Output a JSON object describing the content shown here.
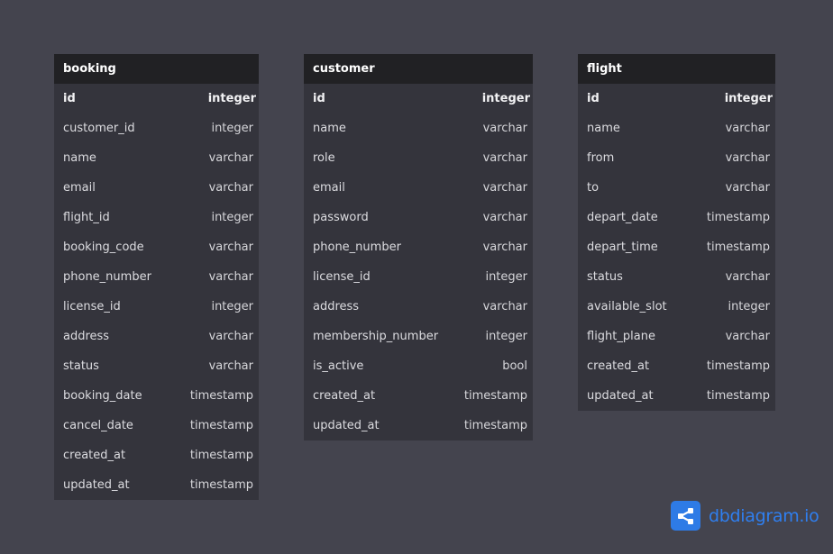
{
  "tables": [
    {
      "name": "booking",
      "columns": [
        {
          "name": "id",
          "type": "integer",
          "pk": true
        },
        {
          "name": "customer_id",
          "type": "integer"
        },
        {
          "name": "name",
          "type": "varchar"
        },
        {
          "name": "email",
          "type": "varchar"
        },
        {
          "name": "flight_id",
          "type": "integer"
        },
        {
          "name": "booking_code",
          "type": "varchar"
        },
        {
          "name": "phone_number",
          "type": "varchar"
        },
        {
          "name": "license_id",
          "type": "integer"
        },
        {
          "name": "address",
          "type": "varchar"
        },
        {
          "name": "status",
          "type": "varchar"
        },
        {
          "name": "booking_date",
          "type": "timestamp"
        },
        {
          "name": "cancel_date",
          "type": "timestamp"
        },
        {
          "name": "created_at",
          "type": "timestamp"
        },
        {
          "name": "updated_at",
          "type": "timestamp"
        }
      ]
    },
    {
      "name": "customer",
      "columns": [
        {
          "name": "id",
          "type": "integer",
          "pk": true
        },
        {
          "name": "name",
          "type": "varchar"
        },
        {
          "name": "role",
          "type": "varchar"
        },
        {
          "name": "email",
          "type": "varchar"
        },
        {
          "name": "password",
          "type": "varchar"
        },
        {
          "name": "phone_number",
          "type": "varchar"
        },
        {
          "name": "license_id",
          "type": "integer"
        },
        {
          "name": "address",
          "type": "varchar"
        },
        {
          "name": "membership_number",
          "type": "integer"
        },
        {
          "name": "is_active",
          "type": "bool"
        },
        {
          "name": "created_at",
          "type": "timestamp"
        },
        {
          "name": "updated_at",
          "type": "timestamp"
        }
      ]
    },
    {
      "name": "flight",
      "columns": [
        {
          "name": "id",
          "type": "integer",
          "pk": true
        },
        {
          "name": "name",
          "type": "varchar"
        },
        {
          "name": "from",
          "type": "varchar"
        },
        {
          "name": "to",
          "type": "varchar"
        },
        {
          "name": "depart_date",
          "type": "timestamp"
        },
        {
          "name": "depart_time",
          "type": "timestamp"
        },
        {
          "name": "status",
          "type": "varchar"
        },
        {
          "name": "available_slot",
          "type": "integer"
        },
        {
          "name": "flight_plane",
          "type": "varchar"
        },
        {
          "name": "created_at",
          "type": "timestamp"
        },
        {
          "name": "updated_at",
          "type": "timestamp"
        }
      ]
    }
  ],
  "brand": {
    "text": "dbdiagram.io",
    "logo_icon": "share-nodes-icon",
    "color": "#2f7ff0"
  },
  "colors": {
    "canvas": "#44444e",
    "table_body": "#34343c",
    "table_header": "#212124"
  }
}
